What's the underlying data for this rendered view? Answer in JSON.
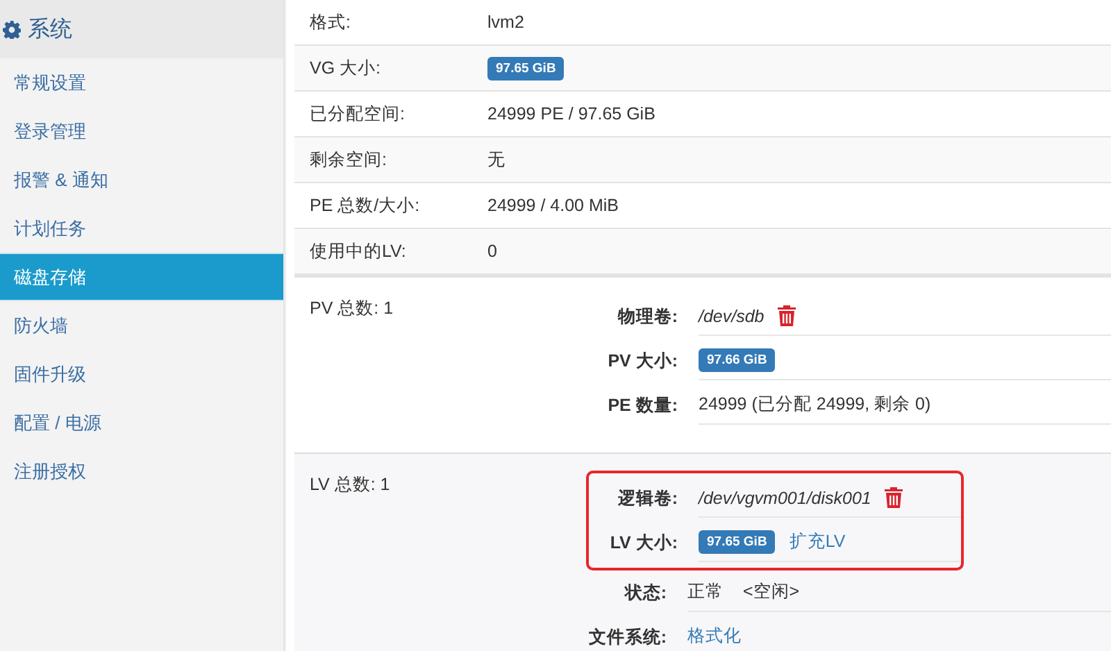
{
  "sidebar": {
    "title": "系统",
    "items": [
      {
        "label": "常规设置",
        "selected": false
      },
      {
        "label": "登录管理",
        "selected": false
      },
      {
        "label": "报警 & 通知",
        "selected": false
      },
      {
        "label": "计划任务",
        "selected": false
      },
      {
        "label": "磁盘存储",
        "selected": true
      },
      {
        "label": "防火墙",
        "selected": false
      },
      {
        "label": "固件升级",
        "selected": false
      },
      {
        "label": "配置 / 电源",
        "selected": false
      },
      {
        "label": "注册授权",
        "selected": false
      }
    ]
  },
  "properties": [
    {
      "label": "格式:",
      "kind": "text",
      "value": "lvm2"
    },
    {
      "label": "VG 大小:",
      "kind": "badge",
      "value": "97.65 GiB"
    },
    {
      "label": "已分配空间:",
      "kind": "text",
      "value": "24999 PE / 97.65 GiB"
    },
    {
      "label": "剩余空间:",
      "kind": "text",
      "value": "无"
    },
    {
      "label": "PE 总数/大小:",
      "kind": "text",
      "value": "24999 / 4.00 MiB"
    },
    {
      "label": "使用中的LV:",
      "kind": "text",
      "value": "0"
    }
  ],
  "sections": [
    {
      "heading": "PV 总数: 1",
      "groups": [
        {
          "highlighted": false,
          "fields": [
            {
              "label": "物理卷:",
              "kind": "path",
              "value": "/dev/sdb"
            },
            {
              "label": "PV 大小:",
              "kind": "badge",
              "value": "97.66 GiB"
            },
            {
              "label": "PE 数量:",
              "kind": "text",
              "value": "24999 (已分配 24999, 剩余 0)"
            }
          ]
        }
      ]
    },
    {
      "heading": "LV 总数: 1",
      "groups": [
        {
          "highlighted": true,
          "fields": [
            {
              "label": "逻辑卷:",
              "kind": "path",
              "value": "/dev/vgvm001/disk001"
            },
            {
              "label": "LV 大小:",
              "kind": "badge",
              "value": "97.65 GiB",
              "link": "扩充LV"
            }
          ]
        },
        {
          "highlighted": false,
          "fields": [
            {
              "label": "状态:",
              "kind": "status",
              "value": "正常",
              "note": "<空闲>"
            },
            {
              "label": "文件系统:",
              "kind": "link",
              "value": "格式化"
            }
          ]
        }
      ]
    }
  ]
}
